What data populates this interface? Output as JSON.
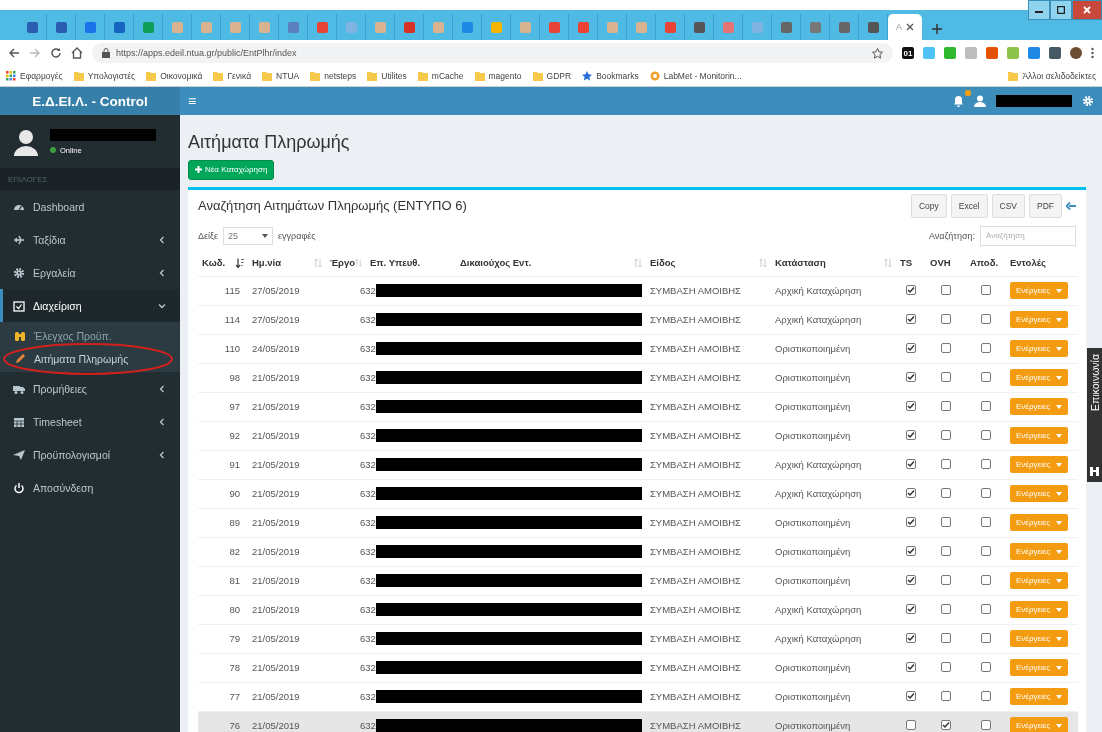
{
  "browser": {
    "tabs": [
      {
        "color": "#2a5db0",
        "selected": false
      },
      {
        "color": "#2a5db0",
        "selected": false
      },
      {
        "color": "#1a73e8",
        "selected": false
      },
      {
        "color": "#1565c0",
        "selected": false
      },
      {
        "color": "#0f9d58",
        "selected": false
      },
      {
        "color": "#d7b48f",
        "selected": false
      },
      {
        "color": "#d7b48f",
        "selected": false
      },
      {
        "color": "#d7b48f",
        "selected": false
      },
      {
        "color": "#d7b48f",
        "selected": false
      },
      {
        "color": "#5b7fbf",
        "selected": false
      },
      {
        "color": "#ea4335",
        "selected": false
      },
      {
        "color": "#7fb3e0",
        "selected": false
      },
      {
        "color": "#d7b48f",
        "selected": false
      },
      {
        "color": "#d93025",
        "selected": false
      },
      {
        "color": "#d7b48f",
        "selected": false
      },
      {
        "color": "#1e88e5",
        "selected": false
      },
      {
        "color": "#f4b400",
        "selected": false
      },
      {
        "color": "#d7b48f",
        "selected": false
      },
      {
        "color": "#ea4335",
        "selected": false
      },
      {
        "color": "#ea4335",
        "selected": false
      },
      {
        "color": "#d7b48f",
        "selected": false
      },
      {
        "color": "#d7b48f",
        "selected": false
      },
      {
        "color": "#ea4335",
        "selected": false
      },
      {
        "color": "#555555",
        "selected": false
      },
      {
        "color": "#e57373",
        "selected": false
      },
      {
        "color": "#7fb3e0",
        "selected": false
      },
      {
        "color": "#666666",
        "selected": false
      },
      {
        "color": "#777777",
        "selected": false
      },
      {
        "color": "#666666",
        "selected": false
      },
      {
        "color": "#555555",
        "selected": false
      },
      {
        "label": "Α",
        "selected": true
      }
    ],
    "url": "https://apps.edeil.ntua.gr/public/EntPlhr/index",
    "extensions": [
      {
        "color": "#111111",
        "label": "01"
      },
      {
        "color": "#4fc3f7"
      },
      {
        "color": "#2eb82e"
      },
      {
        "color": "#bdbdbd"
      },
      {
        "color": "#e65100"
      },
      {
        "color": "#8bc34a"
      },
      {
        "color": "#1e88e5"
      },
      {
        "color": "#455a64"
      }
    ],
    "bookmarks": [
      {
        "kind": "apps",
        "label": "Εφαρμογές"
      },
      {
        "kind": "folder",
        "label": "Υπολογιστές"
      },
      {
        "kind": "folder",
        "label": "Οικονομικά"
      },
      {
        "kind": "folder",
        "label": "Γενικά"
      },
      {
        "kind": "folder",
        "label": "NTUA"
      },
      {
        "kind": "folder",
        "label": "netsteps"
      },
      {
        "kind": "folder",
        "label": "Utilites"
      },
      {
        "kind": "folder",
        "label": "mCache"
      },
      {
        "kind": "folder",
        "label": "magento"
      },
      {
        "kind": "folder",
        "label": "GDPR"
      },
      {
        "kind": "star",
        "label": "Bookmarks"
      },
      {
        "kind": "site",
        "label": "LabMet - Monitorin..."
      }
    ],
    "other_bookmarks": "Άλλοι σελιδοδείκτες"
  },
  "header": {
    "brand": "Ε.Δ.ΕΙ.Λ. - Control",
    "menu": "≡",
    "user_redacted": true
  },
  "sidebar": {
    "user": {
      "status": "Online",
      "name_redacted": true
    },
    "section": "ΕΠΙΛΟΓΕΣ",
    "items": [
      {
        "label": "Dashboard",
        "kind": "link",
        "active": false
      },
      {
        "label": "Ταξίδια",
        "kind": "tree",
        "expanded": false,
        "active": false
      },
      {
        "label": "Εργαλεία",
        "kind": "tree",
        "expanded": false,
        "active": false
      },
      {
        "label": "Διαχείριση",
        "kind": "tree",
        "expanded": true,
        "active": true,
        "children": [
          {
            "label": "Έλεγχος Προϋπ.",
            "selected": false,
            "circled": false
          },
          {
            "label": "Αιτήματα Πληρωμής",
            "selected": true,
            "circled": true
          }
        ]
      },
      {
        "label": "Προμήθειες",
        "kind": "tree",
        "expanded": false,
        "active": false
      },
      {
        "label": "Timesheet",
        "kind": "tree",
        "expanded": false,
        "active": false
      },
      {
        "label": "Προϋπολογισμοί",
        "kind": "tree",
        "expanded": false,
        "active": false
      },
      {
        "label": "Αποσύνδεση",
        "kind": "link",
        "active": false
      }
    ]
  },
  "content": {
    "title": "Αιτήματα Πληρωμής",
    "new_button": "Νέα Καταχώρηση",
    "box": {
      "title": "Αναζήτηση Αιτημάτων Πληρωμής (ΕΝΤΥΠΟ 6)",
      "export_buttons": [
        "Copy",
        "Excel",
        "CSV",
        "PDF"
      ],
      "length": {
        "prefix": "Δείξε",
        "value": "25",
        "suffix": "εγγραφές"
      },
      "search": {
        "label": "Αναζήτηση:",
        "placeholder": "Αναζήτηση"
      },
      "columns": [
        {
          "label": "Κωδ.",
          "sortable": true,
          "sorted_desc": true
        },
        {
          "label": "Ημ.νία",
          "sortable": true,
          "sorted_desc": false
        },
        {
          "label": "Έργο",
          "sortable": true,
          "sorted_desc": false
        },
        {
          "label": "Επ. Υπευθ.",
          "sortable": false,
          "sorted_desc": false
        },
        {
          "label": "Δικαιούχος Εντ.",
          "sortable": true,
          "sorted_desc": false
        },
        {
          "label": "Είδος",
          "sortable": true,
          "sorted_desc": false
        },
        {
          "label": "Κατάσταση",
          "sortable": true,
          "sorted_desc": false
        },
        {
          "label": "TS",
          "sortable": false,
          "sorted_desc": false
        },
        {
          "label": "OVH",
          "sortable": false,
          "sorted_desc": false
        },
        {
          "label": "Αποδ.",
          "sortable": false,
          "sorted_desc": false
        },
        {
          "label": "Εντολές",
          "sortable": false,
          "sorted_desc": false
        }
      ],
      "rows": [
        {
          "code": "115",
          "date": "27/05/2019",
          "project": "632",
          "redacted": true,
          "type": "ΣΥΜΒΑΣΗ ΑΜΟΙΒΗΣ",
          "status": "Αρχική Καταχώρηση",
          "ts": true,
          "ovh": false,
          "apod": false,
          "action": "Ενέργειες",
          "highlighted": false
        },
        {
          "code": "114",
          "date": "27/05/2019",
          "project": "632",
          "redacted": true,
          "type": "ΣΥΜΒΑΣΗ ΑΜΟΙΒΗΣ",
          "status": "Αρχική Καταχώρηση",
          "ts": true,
          "ovh": false,
          "apod": false,
          "action": "Ενέργειες",
          "highlighted": false
        },
        {
          "code": "110",
          "date": "24/05/2019",
          "project": "632",
          "redacted": true,
          "type": "ΣΥΜΒΑΣΗ ΑΜΟΙΒΗΣ",
          "status": "Οριστικοποιημένη",
          "ts": true,
          "ovh": false,
          "apod": false,
          "action": "Ενέργειες",
          "highlighted": false
        },
        {
          "code": "98",
          "date": "21/05/2019",
          "project": "632",
          "redacted": true,
          "type": "ΣΥΜΒΑΣΗ ΑΜΟΙΒΗΣ",
          "status": "Οριστικοποιημένη",
          "ts": true,
          "ovh": false,
          "apod": false,
          "action": "Ενέργειες",
          "highlighted": false
        },
        {
          "code": "97",
          "date": "21/05/2019",
          "project": "632",
          "redacted": true,
          "type": "ΣΥΜΒΑΣΗ ΑΜΟΙΒΗΣ",
          "status": "Οριστικοποιημένη",
          "ts": true,
          "ovh": false,
          "apod": false,
          "action": "Ενέργειες",
          "highlighted": false
        },
        {
          "code": "92",
          "date": "21/05/2019",
          "project": "632",
          "redacted": true,
          "type": "ΣΥΜΒΑΣΗ ΑΜΟΙΒΗΣ",
          "status": "Οριστικοποιημένη",
          "ts": true,
          "ovh": false,
          "apod": false,
          "action": "Ενέργειες",
          "highlighted": false
        },
        {
          "code": "91",
          "date": "21/05/2019",
          "project": "632",
          "redacted": true,
          "type": "ΣΥΜΒΑΣΗ ΑΜΟΙΒΗΣ",
          "status": "Αρχική Καταχώρηση",
          "ts": true,
          "ovh": false,
          "apod": false,
          "action": "Ενέργειες",
          "highlighted": false
        },
        {
          "code": "90",
          "date": "21/05/2019",
          "project": "632",
          "redacted": true,
          "type": "ΣΥΜΒΑΣΗ ΑΜΟΙΒΗΣ",
          "status": "Αρχική Καταχώρηση",
          "ts": true,
          "ovh": false,
          "apod": false,
          "action": "Ενέργειες",
          "highlighted": false
        },
        {
          "code": "89",
          "date": "21/05/2019",
          "project": "632",
          "redacted": true,
          "type": "ΣΥΜΒΑΣΗ ΑΜΟΙΒΗΣ",
          "status": "Οριστικοποιημένη",
          "ts": true,
          "ovh": false,
          "apod": false,
          "action": "Ενέργειες",
          "highlighted": false
        },
        {
          "code": "82",
          "date": "21/05/2019",
          "project": "632",
          "redacted": true,
          "type": "ΣΥΜΒΑΣΗ ΑΜΟΙΒΗΣ",
          "status": "Οριστικοποιημένη",
          "ts": true,
          "ovh": false,
          "apod": false,
          "action": "Ενέργειες",
          "highlighted": false
        },
        {
          "code": "81",
          "date": "21/05/2019",
          "project": "632",
          "redacted": true,
          "type": "ΣΥΜΒΑΣΗ ΑΜΟΙΒΗΣ",
          "status": "Οριστικοποιημένη",
          "ts": true,
          "ovh": false,
          "apod": false,
          "action": "Ενέργειες",
          "highlighted": false
        },
        {
          "code": "80",
          "date": "21/05/2019",
          "project": "632",
          "redacted": true,
          "type": "ΣΥΜΒΑΣΗ ΑΜΟΙΒΗΣ",
          "status": "Αρχική Καταχώρηση",
          "ts": true,
          "ovh": false,
          "apod": false,
          "action": "Ενέργειες",
          "highlighted": false
        },
        {
          "code": "79",
          "date": "21/05/2019",
          "project": "632",
          "redacted": true,
          "type": "ΣΥΜΒΑΣΗ ΑΜΟΙΒΗΣ",
          "status": "Αρχική Καταχώρηση",
          "ts": true,
          "ovh": false,
          "apod": false,
          "action": "Ενέργειες",
          "highlighted": false
        },
        {
          "code": "78",
          "date": "21/05/2019",
          "project": "632",
          "redacted": true,
          "type": "ΣΥΜΒΑΣΗ ΑΜΟΙΒΗΣ",
          "status": "Οριστικοποιημένη",
          "ts": true,
          "ovh": false,
          "apod": false,
          "action": "Ενέργειες",
          "highlighted": false
        },
        {
          "code": "77",
          "date": "21/05/2019",
          "project": "632",
          "redacted": true,
          "type": "ΣΥΜΒΑΣΗ ΑΜΟΙΒΗΣ",
          "status": "Οριστικοποιημένη",
          "ts": true,
          "ovh": false,
          "apod": false,
          "action": "Ενέργειες",
          "highlighted": false
        },
        {
          "code": "76",
          "date": "21/05/2019",
          "project": "632",
          "redacted": true,
          "type": "ΣΥΜΒΑΣΗ ΑΜΟΙΒΗΣ",
          "status": "Οριστικοποιημένη",
          "ts": false,
          "ovh": true,
          "apod": false,
          "action": "Ενέργειες",
          "highlighted": true
        }
      ]
    }
  },
  "side_tab": {
    "label": "Επικοινωνία"
  }
}
